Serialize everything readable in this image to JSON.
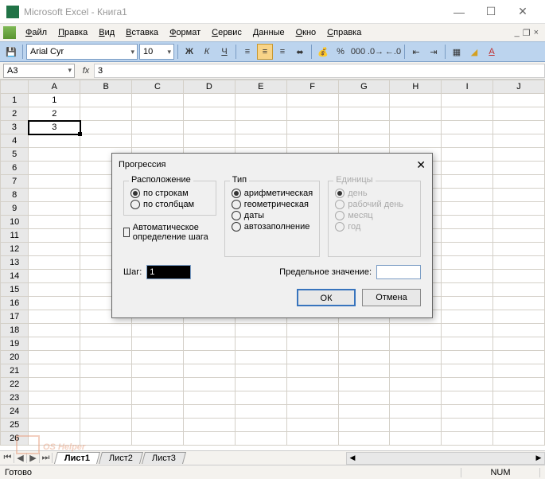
{
  "window": {
    "title": "Microsoft Excel - Книга1"
  },
  "menu": {
    "items": [
      "Файл",
      "Правка",
      "Вид",
      "Вставка",
      "Формат",
      "Сервис",
      "Данные",
      "Окно",
      "Справка"
    ]
  },
  "toolbar": {
    "font": "Arial Cyr",
    "size": "10"
  },
  "formula": {
    "cellref": "A3",
    "fx": "fx",
    "value": "3"
  },
  "columns": [
    "A",
    "B",
    "C",
    "D",
    "E",
    "F",
    "G",
    "H",
    "I",
    "J"
  ],
  "rows_visible": 26,
  "cells": {
    "A1": "1",
    "A2": "2",
    "A3": "3"
  },
  "selected_cell": "A3",
  "sheets": {
    "active": "Лист1",
    "tabs": [
      "Лист1",
      "Лист2",
      "Лист3"
    ]
  },
  "status": {
    "left": "Готово",
    "num": "NUM"
  },
  "dialog": {
    "title": "Прогрессия",
    "layout": {
      "legend": "Расположение",
      "rows": "по строкам",
      "cols": "по столбцам"
    },
    "auto_step": "Автоматическое определение шага",
    "type": {
      "legend": "Тип",
      "arith": "арифметическая",
      "geom": "геометрическая",
      "dates": "даты",
      "autofill": "автозаполнение"
    },
    "units": {
      "legend": "Единицы",
      "day": "день",
      "workday": "рабочий день",
      "month": "месяц",
      "year": "год"
    },
    "step_label": "Шаг:",
    "step_value": "1",
    "limit_label": "Предельное значение:",
    "limit_value": "",
    "ok": "ОК",
    "cancel": "Отмена"
  },
  "watermark": "OS Helper"
}
